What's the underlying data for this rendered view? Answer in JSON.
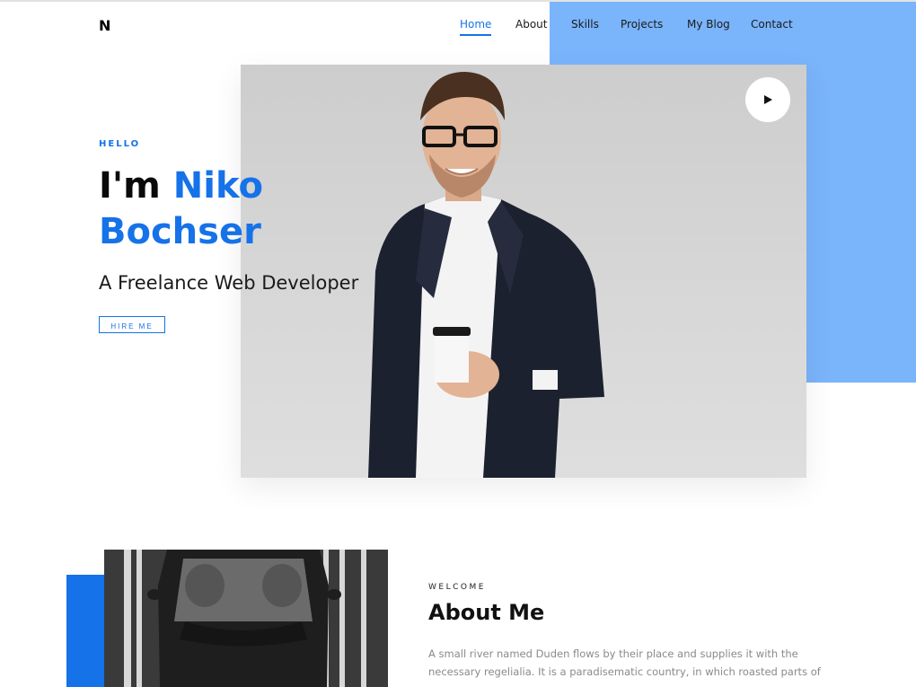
{
  "brand": {
    "logo": "N"
  },
  "nav": {
    "items": [
      {
        "label": "Home",
        "active": true
      },
      {
        "label": "About",
        "active": false
      },
      {
        "label": "Skills",
        "active": false
      },
      {
        "label": "Projects",
        "active": false
      },
      {
        "label": "My Blog",
        "active": false
      },
      {
        "label": "Contact",
        "active": false
      }
    ]
  },
  "hero": {
    "greeting": "HELLO",
    "title_prefix": "I'm",
    "title_name": "Niko Bochser",
    "subtitle": "A Freelance Web Developer",
    "cta_label": "HIRE ME",
    "play_icon": "play-icon"
  },
  "about": {
    "eyebrow": "WELCOME",
    "title": "About Me",
    "text": "A small river named Duden flows by their place and supplies it with the necessary regelialia. It is a paradisematic country, in which roasted parts of"
  },
  "colors": {
    "accent": "#1672e8",
    "panel": "#7ab4fb"
  }
}
